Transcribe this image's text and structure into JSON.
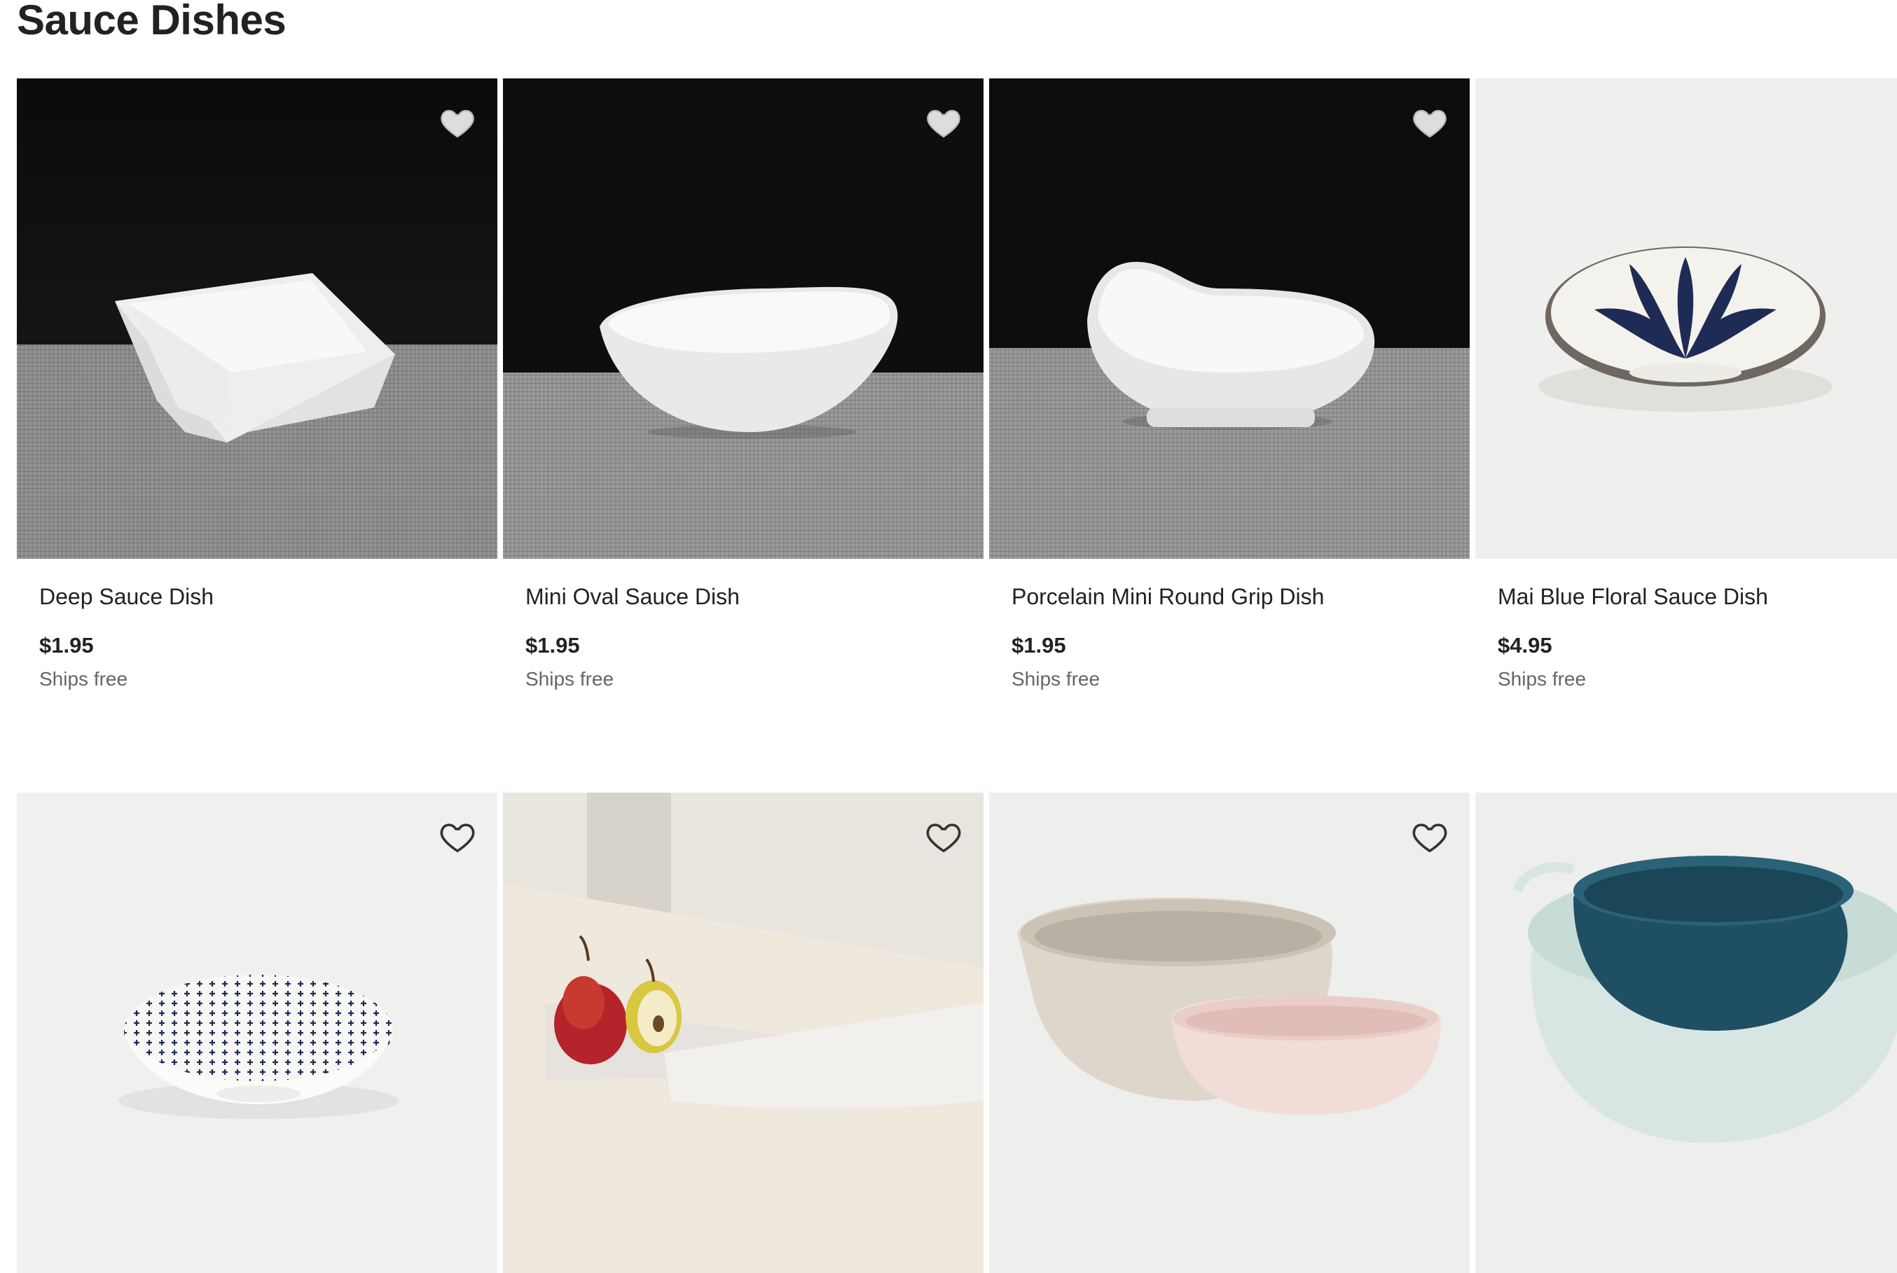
{
  "page": {
    "title": "Sauce Dishes"
  },
  "products": [
    {
      "name": "Deep Sauce Dish",
      "price": "$1.95",
      "shipping": "Ships free",
      "image": "white-square-dish-on-dark-linen"
    },
    {
      "name": "Mini Oval Sauce Dish",
      "price": "$1.95",
      "shipping": "Ships free",
      "image": "white-oval-dish-on-dark-linen"
    },
    {
      "name": "Porcelain Mini Round Grip Dish",
      "price": "$1.95",
      "shipping": "Ships free",
      "image": "white-round-grip-dish-on-dark-linen"
    },
    {
      "name": "Mai Blue Floral Sauce Dish",
      "price": "$4.95",
      "shipping": "Ships free",
      "image": "blue-floral-dish"
    },
    {
      "image": "blue-cross-pattern-dish"
    },
    {
      "image": "half-moon-plates-with-pears"
    },
    {
      "image": "beige-and-pink-bowls"
    },
    {
      "image": "nested-teal-bowls"
    }
  ],
  "icons": {
    "favorite": "heart-outline-icon"
  },
  "colors": {
    "text": "#222222",
    "muted": "#666666",
    "heart_on_dark": "#dddddd",
    "heart_on_light": "#333333"
  }
}
